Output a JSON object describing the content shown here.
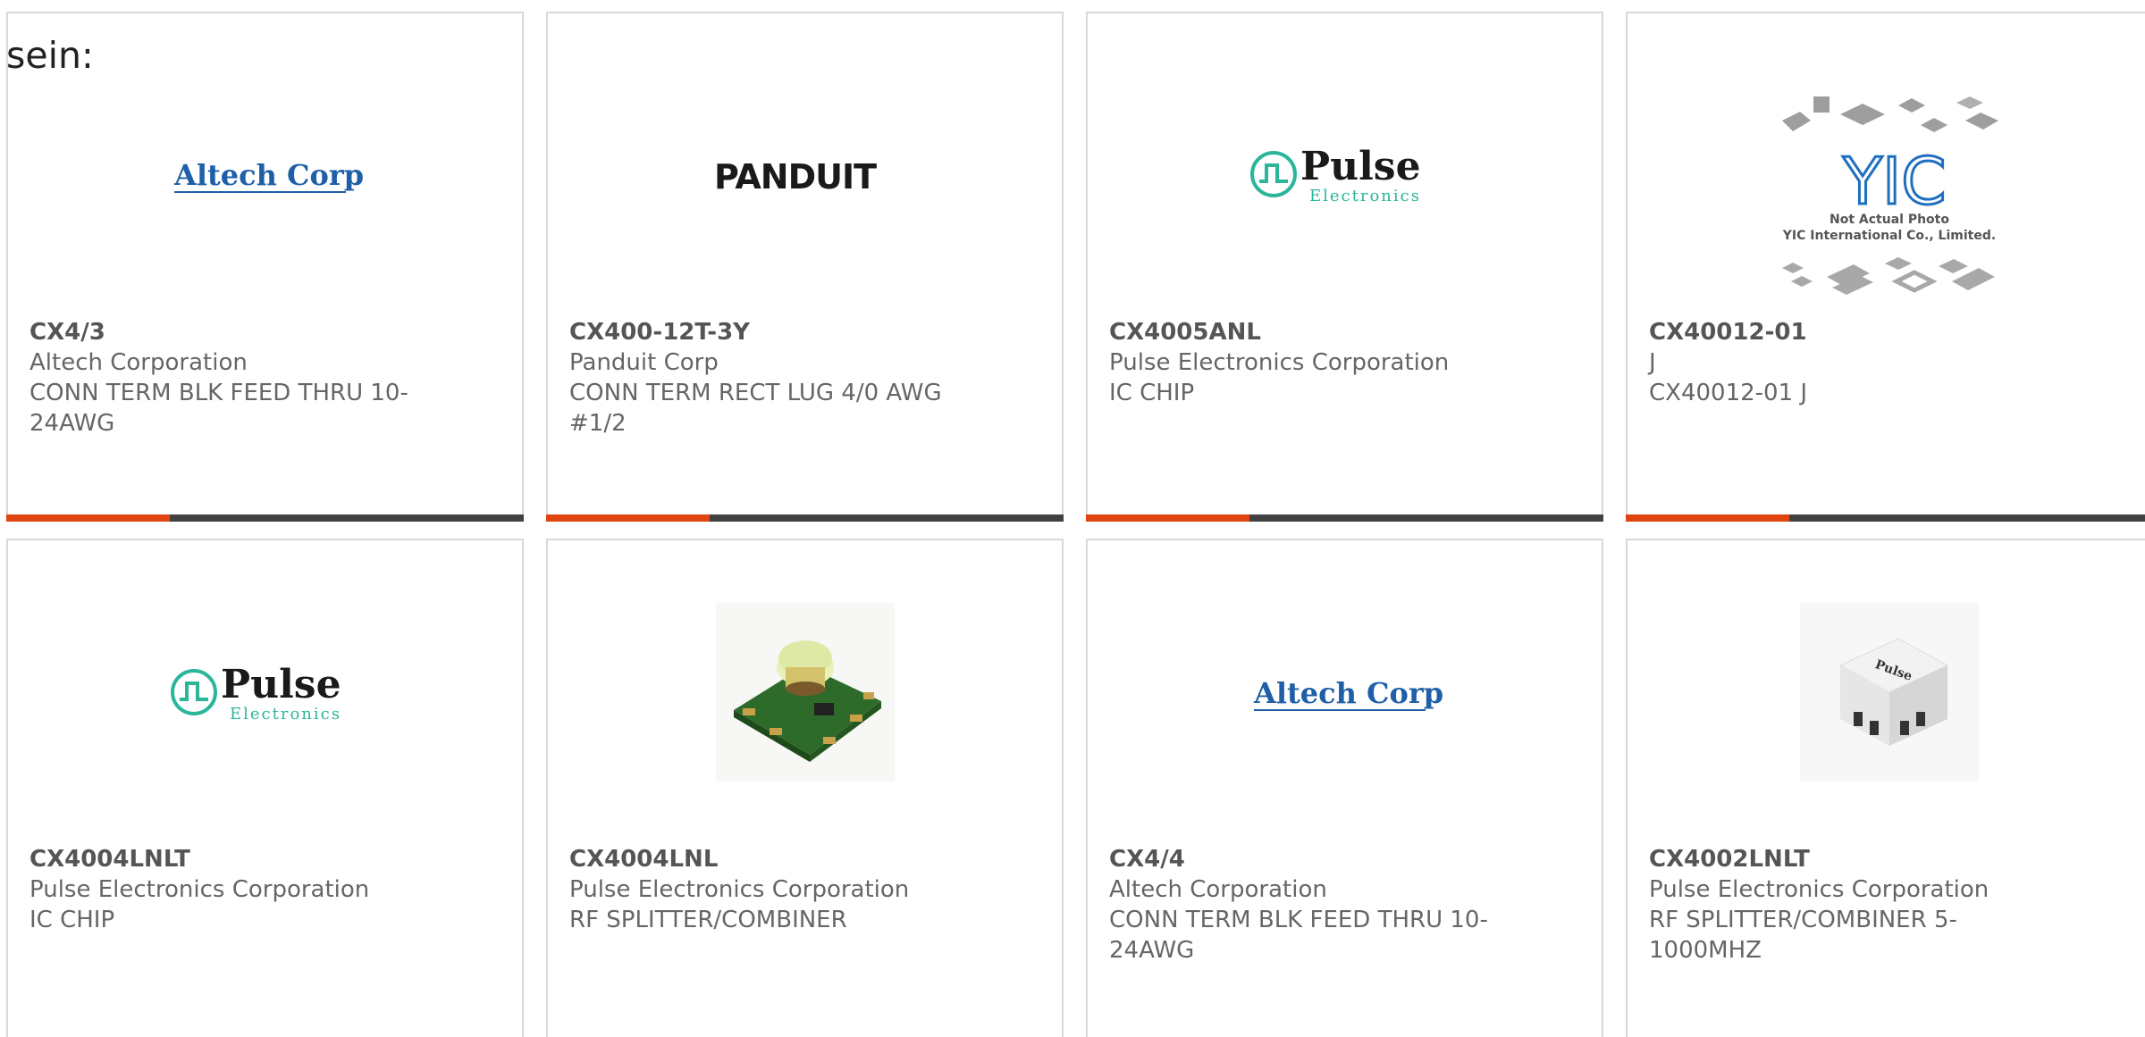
{
  "intro_text": "sein:",
  "accent_color": "#e0440f",
  "products": [
    {
      "part": "CX4/3",
      "manufacturer": "Altech Corporation",
      "description": "CONN TERM BLK FEED THRU 10-24AWG",
      "image_logo_text": "Altech Corp.",
      "image_type": "altech-logo"
    },
    {
      "part": "CX400-12T-3Y",
      "manufacturer": "Panduit Corp",
      "description": "CONN TERM RECT LUG 4/0 AWG #1/2",
      "image_logo_text": "PANDUIT",
      "image_type": "panduit-logo"
    },
    {
      "part": "CX4005ANL",
      "manufacturer": "Pulse Electronics Corporation",
      "description": "IC CHIP",
      "image_logo_text": "Pulse",
      "image_logo_subtext": "Electronics",
      "image_type": "pulse-logo"
    },
    {
      "part": "CX40012-01",
      "manufacturer": "J",
      "description": "CX40012-01 J",
      "image_logo_text": "YIC",
      "image_caption_1": "Not Actual Photo",
      "image_caption_2": "YIC International Co., Limited.",
      "image_type": "yic-placeholder"
    },
    {
      "part": "CX4004LNLT",
      "manufacturer": "Pulse Electronics Corporation",
      "description": "IC CHIP",
      "image_logo_text": "Pulse",
      "image_logo_subtext": "Electronics",
      "image_type": "pulse-logo"
    },
    {
      "part": "CX4004LNL",
      "manufacturer": "Pulse Electronics Corporation",
      "description": "RF SPLITTER/COMBINER",
      "image_type": "rf-module-photo"
    },
    {
      "part": "CX4/4",
      "manufacturer": "Altech Corporation",
      "description": "CONN TERM BLK FEED THRU 10-24AWG",
      "image_logo_text": "Altech Corp.",
      "image_type": "altech-logo"
    },
    {
      "part": "CX4002LNLT",
      "manufacturer": "Pulse Electronics Corporation",
      "description": "RF SPLITTER/COMBINER 5-1000MHZ",
      "image_logo_text": "Pulse",
      "image_type": "smd-component-photo"
    }
  ]
}
